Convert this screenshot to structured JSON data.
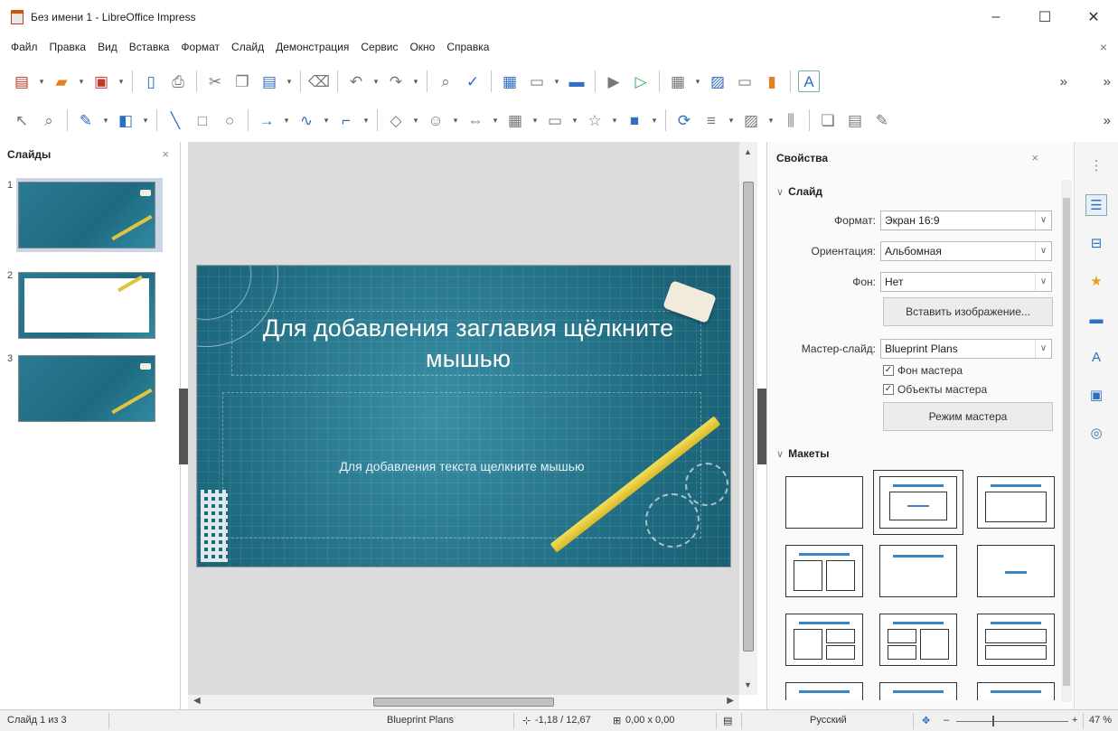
{
  "window": {
    "title": "Без имени 1 - LibreOffice Impress",
    "minimize": "–",
    "maximize": "☐",
    "close": "✕"
  },
  "menu": {
    "items": [
      "Файл",
      "Правка",
      "Вид",
      "Вставка",
      "Формат",
      "Слайд",
      "Демонстрация",
      "Сервис",
      "Окно",
      "Справка"
    ],
    "close": "×"
  },
  "toolbar": {
    "overflow": "»"
  },
  "slides_pane": {
    "title": "Слайды",
    "close": "×",
    "slides": [
      {
        "number": "1"
      },
      {
        "number": "2"
      },
      {
        "number": "3"
      }
    ]
  },
  "slide": {
    "title_placeholder": "Для добавления заглавия щёлкните мышью",
    "body_placeholder": "Для добавления текста щелкните мышью"
  },
  "properties": {
    "header": "Свойства",
    "close": "×",
    "slide_section": "Слайд",
    "format_label": "Формат:",
    "format_value": "Экран 16:9",
    "orientation_label": "Ориентация:",
    "orientation_value": "Альбомная",
    "background_label": "Фон:",
    "background_value": "Нет",
    "insert_image_button": "Вставить изображение...",
    "master_slide_label": "Мастер-слайд:",
    "master_slide_value": "Blueprint Plans",
    "master_background_checkbox": "Фон мастера",
    "master_objects_checkbox": "Объекты мастера",
    "master_mode_button": "Режим мастера",
    "layouts_section": "Макеты"
  },
  "statusbar": {
    "slide_counter": "Слайд 1 из 3",
    "master_name": "Blueprint Plans",
    "position": "-1,18 / 12,67",
    "size": "0,00 x 0,00",
    "language": "Русский",
    "zoom_minus": "–",
    "zoom_plus": "+",
    "zoom": "47 %"
  },
  "colors": {
    "slide_background": "#1e6a80",
    "accent": "#3b86c4",
    "selection": "#c8d6e8"
  }
}
